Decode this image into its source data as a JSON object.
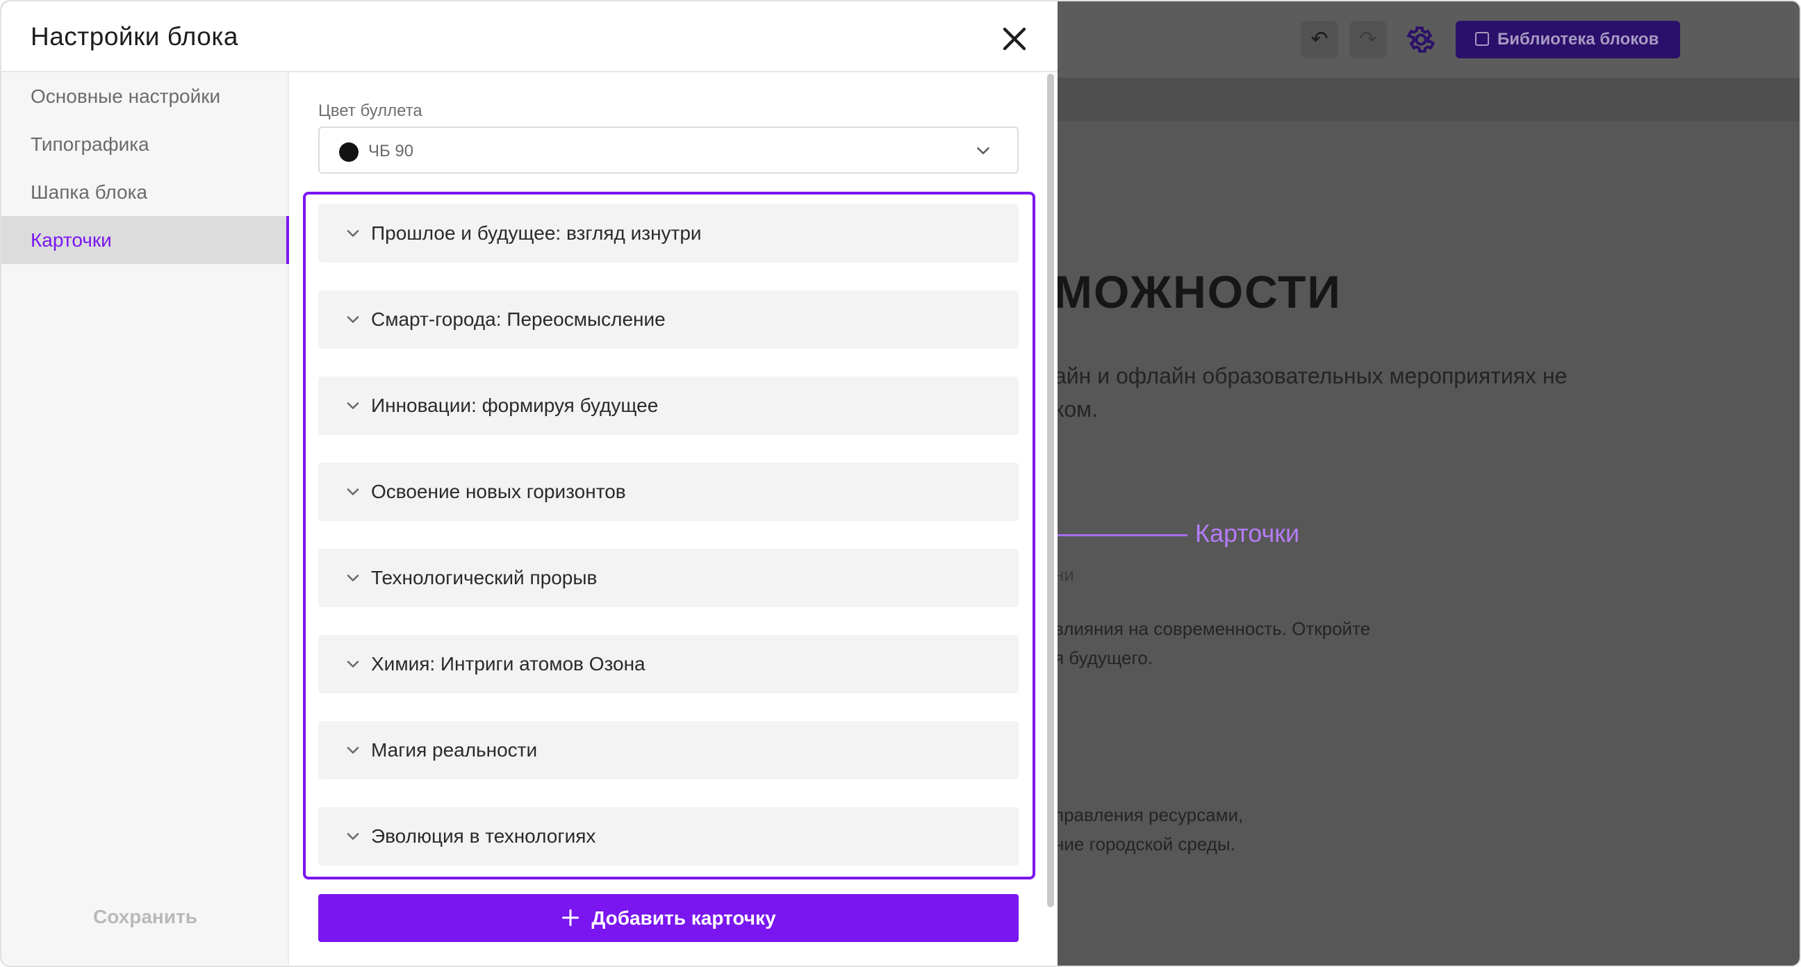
{
  "background": {
    "toolbar": {
      "undo_icon": "undo-icon",
      "redo_icon": "redo-icon",
      "settings_icon": "gear-icon",
      "library_label": "Библиотека блоков"
    },
    "heading": "МОЖНОСТИ",
    "intro_line1": "айн и офлайн образовательных мероприятиях не",
    "intro_line2": "ком.",
    "meta": "ни",
    "card1_line1": "влияния на современность. Откройте",
    "card1_line2": "я будущего.",
    "card2_line1": "правления ресурсами,",
    "card2_line2": "ние городской среды."
  },
  "annotation": {
    "label": "Карточки",
    "color": "#b57cf7"
  },
  "modal": {
    "title": "Настройки блока",
    "close_icon": "close-icon",
    "sidebar": {
      "items": [
        {
          "label": "Основные настройки",
          "active": false
        },
        {
          "label": "Типографика",
          "active": false
        },
        {
          "label": "Шапка блока",
          "active": false
        },
        {
          "label": "Карточки",
          "active": true
        }
      ],
      "save_label": "Сохранить"
    },
    "bullet_color": {
      "label": "Цвет буллета",
      "value": "ЧБ 90",
      "swatch": "#121212"
    },
    "cards": [
      {
        "title": "Прошлое и будущее: взгляд изнутри"
      },
      {
        "title": "Смарт-города: Переосмысление"
      },
      {
        "title": "Инновации: формируя будущее"
      },
      {
        "title": "Освоение новых горизонтов"
      },
      {
        "title": "Технологический прорыв"
      },
      {
        "title": "Химия: Интриги атомов Озона"
      },
      {
        "title": "Магия реальности"
      },
      {
        "title": "Эволюция в технологиях"
      }
    ],
    "add_button_label": "Добавить карточку",
    "accent": "#7a16f0"
  }
}
